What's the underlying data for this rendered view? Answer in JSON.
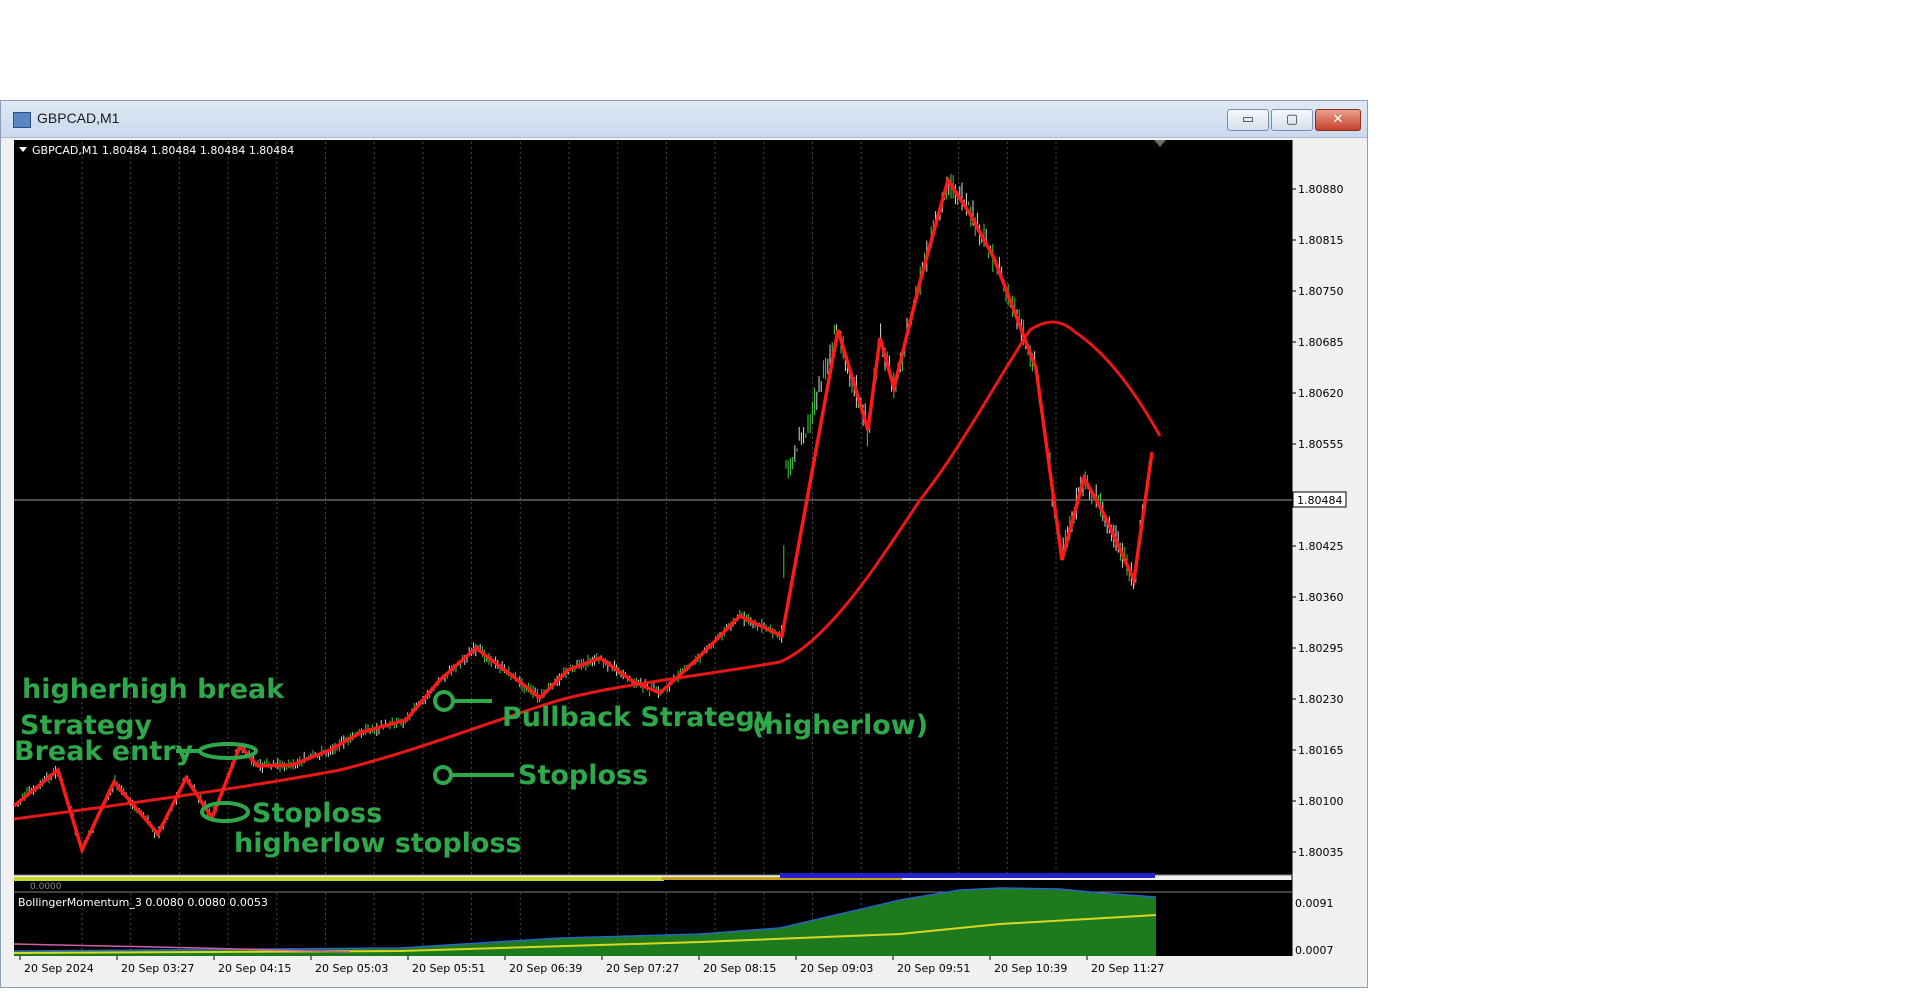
{
  "window": {
    "title": "GBPCAD,M1",
    "controls": {
      "minimize": "▭",
      "maximize": "▢",
      "close": "✕"
    }
  },
  "chart": {
    "header": "GBPCAD,M1  1.80484 1.80484 1.80484 1.80484",
    "current_price": "1.80484",
    "price_labels": [
      "1.80880",
      "1.80815",
      "1.80750",
      "1.80685",
      "1.80620",
      "1.80555",
      "1.80425",
      "1.80360",
      "1.80295",
      "1.80230",
      "1.80165",
      "1.80100",
      "1.80035"
    ],
    "time_labels": [
      "20 Sep 2024",
      "20 Sep 03:27",
      "20 Sep 04:15",
      "20 Sep 05:03",
      "20 Sep 05:51",
      "20 Sep 06:39",
      "20 Sep 07:27",
      "20 Sep 08:15",
      "20 Sep 09:03",
      "20 Sep 09:51",
      "20 Sep 10:39",
      "20 Sep 11:27"
    ]
  },
  "indicator": {
    "name": "BollingerMomentum_3 0.0080 0.0080 0.0053",
    "labels": [
      "0.0091",
      "0.0007"
    ],
    "top_label": "0.0000"
  },
  "annotations": {
    "higherhigh_line1": "higherhigh break",
    "higherhigh_line2": "Strategy",
    "break_entry": "Break entry",
    "stoploss_left": "Stoploss",
    "higherlow_stoploss": "higherlow stoploss",
    "pullback": "Pullback Strategy",
    "higherlow": "(higherlow)",
    "stoploss_mid": "Stoploss"
  },
  "colors": {
    "background": "#000000",
    "bull_candle": "#3fcf3f",
    "bear_candle": "#d8d8d8",
    "zigzag": "#ff1a1a",
    "moving_average": "#e81818",
    "annotation": "#2ea84a",
    "momentum_fill": "#1d7a1d",
    "momentum_line": "#d8d820",
    "grid": "#4a4a4a"
  }
}
